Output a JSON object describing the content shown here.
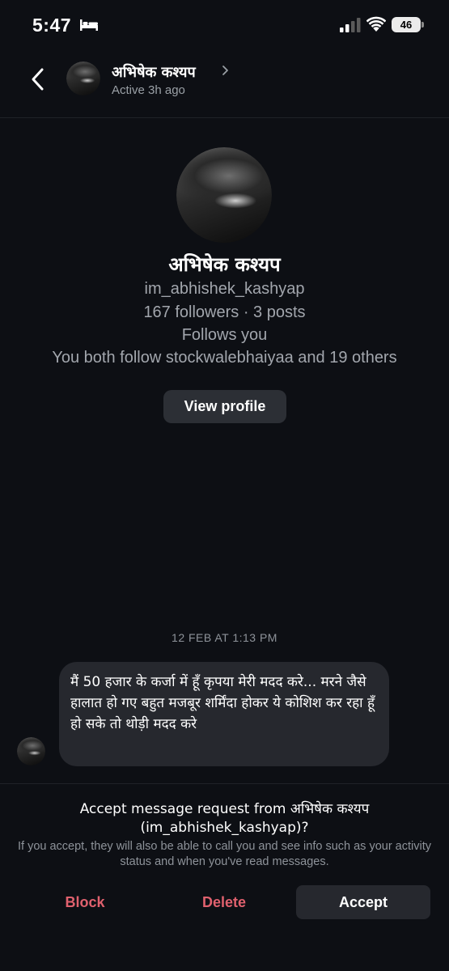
{
  "status_bar": {
    "time": "5:47",
    "battery": "46",
    "icons": [
      "bed-icon",
      "signal-icon",
      "wifi-icon",
      "battery-icon"
    ]
  },
  "header": {
    "name": "अभिषेक कश्यप",
    "status": "Active 3h ago",
    "icons": [
      "back-chevron-icon",
      "chevron-right-icon"
    ]
  },
  "profile": {
    "name": "अभिषेक कश्यप",
    "username": "im_abhishek_kashyap",
    "stats": "167 followers · 3 posts",
    "follows_you": "Follows you",
    "mutual": "You both follow stockwalebhaiyaa and 19 others",
    "view_profile_label": "View profile"
  },
  "conversation": {
    "timestamp": "12 FEB AT 1:13 PM",
    "message": "मैं 50 हजार के कर्जा में हूँ कृपया मेरी मदद करे... मरने जैसे हालात हो गए बहुत मजबूर शर्मिंदा होकर ये कोशिश कर रहा हूँ हो सके तो थोड़ी मदद करे"
  },
  "request": {
    "title_line1": "Accept message request from अभिषेक कश्यप",
    "title_line2": "(im_abhishek_kashyap)?",
    "info": "If you accept, they will also be able to call you and see info such as your activity status and when you've read messages.",
    "block_label": "Block",
    "delete_label": "Delete",
    "accept_label": "Accept"
  },
  "colors": {
    "background": "#0d0f14",
    "bubble": "#26282e",
    "destructive": "#e0616e",
    "secondary_text": "#a2a6ad"
  }
}
